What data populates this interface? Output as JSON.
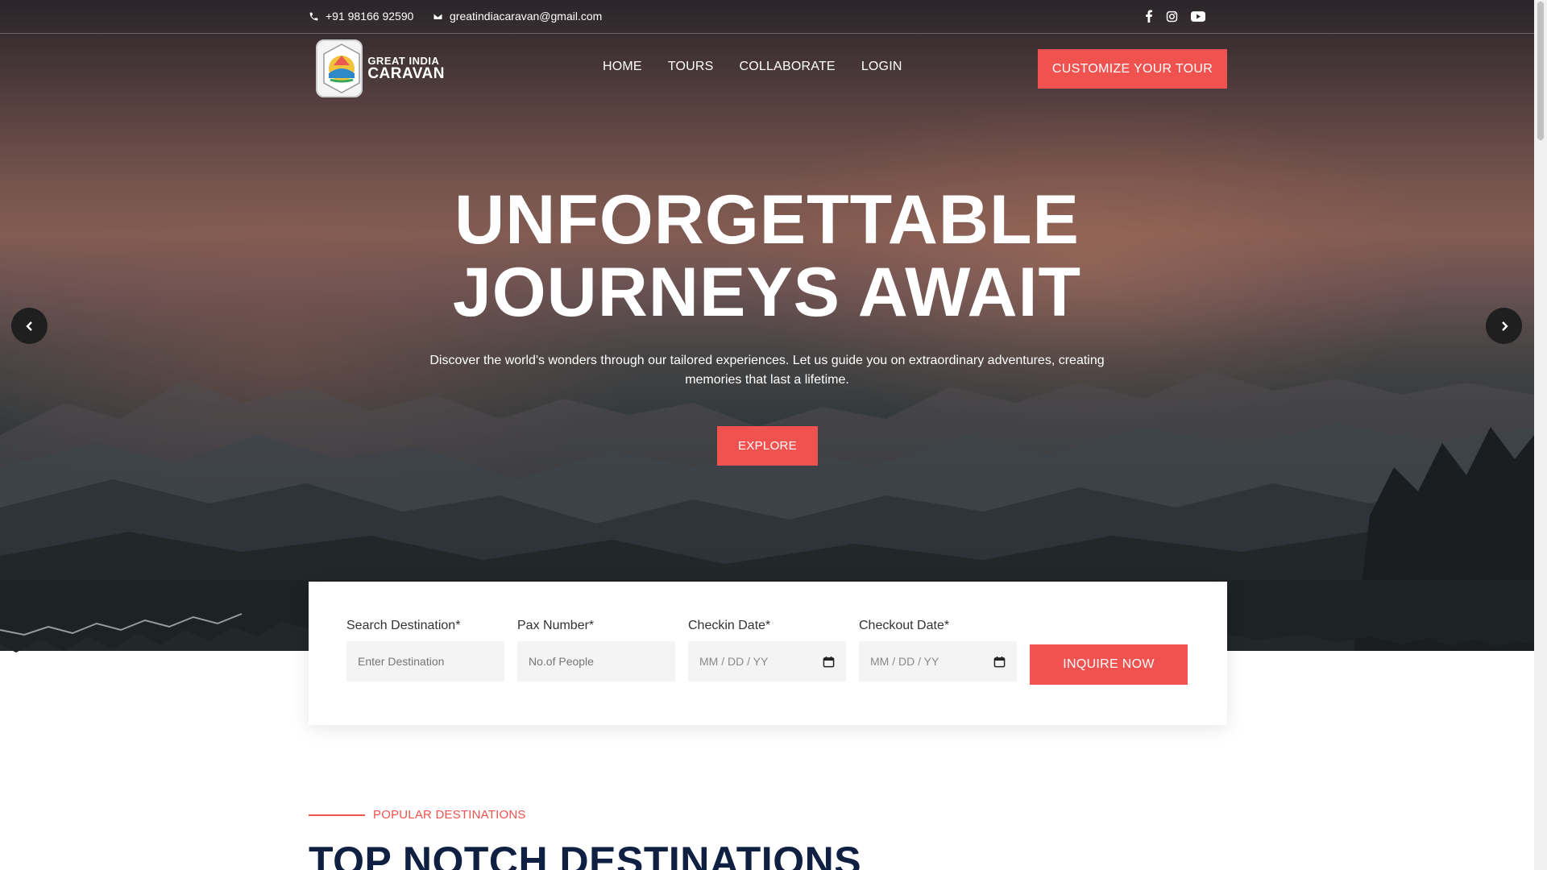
{
  "topbar": {
    "phone": "+91 98166 92590",
    "email": "greatindiacaravan@gmail.com",
    "socials": [
      "facebook-icon",
      "instagram-icon",
      "youtube-icon"
    ]
  },
  "logo": {
    "line1": "GREAT INDIA",
    "line2": "CARAVAN"
  },
  "nav": {
    "items": [
      {
        "label": "HOME"
      },
      {
        "label": "TOURS"
      },
      {
        "label": "COLLABORATE"
      },
      {
        "label": "LOGIN"
      }
    ],
    "cta_label": "CUSTOMIZE YOUR TOUR"
  },
  "hero": {
    "headline_line1": "UNFORGETTABLE",
    "headline_line2": "JOURNEYS AWAIT",
    "subtext": "Discover the world's wonders through our tailored experiences. Let us guide you on extraordinary adventures, creating memories that last a lifetime.",
    "explore_label": "EXPLORE"
  },
  "search_form": {
    "destination": {
      "label": "Search Destination*",
      "placeholder": "Enter Destination"
    },
    "pax": {
      "label": "Pax Number*",
      "placeholder": "No.of People"
    },
    "checkin": {
      "label": "Checkin Date*",
      "placeholder": "MM / DD / YY"
    },
    "checkout": {
      "label": "Checkout Date*",
      "placeholder": "MM / DD / YY"
    },
    "submit_label": "INQUIRE NOW"
  },
  "popular": {
    "eyebrow": "POPULAR DESTINATIONS",
    "title": "TOP NOTCH DESTINATIONS"
  },
  "colors": {
    "accent": "#f0524f",
    "title": "#102043"
  }
}
